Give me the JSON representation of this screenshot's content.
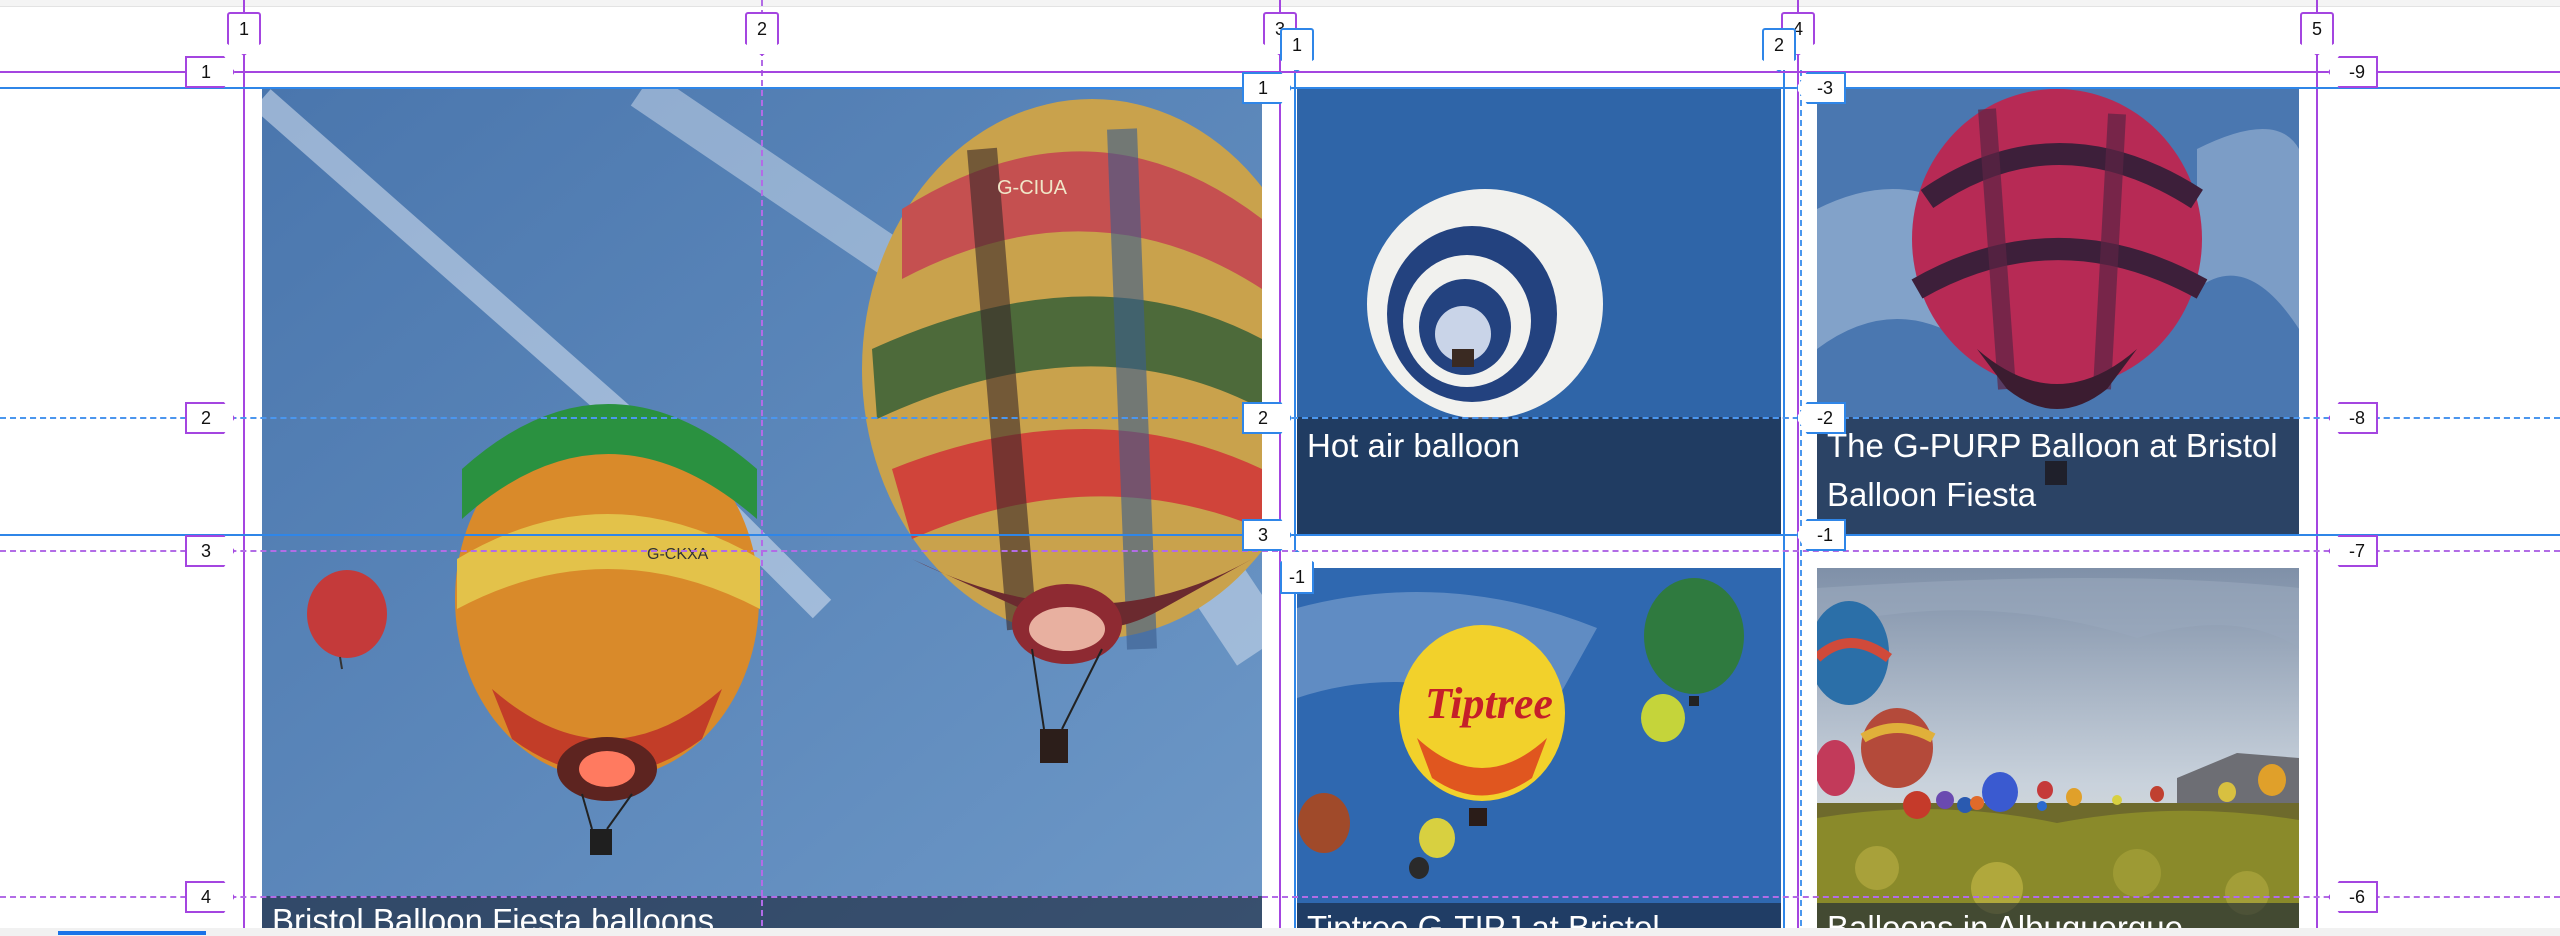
{
  "gallery": {
    "items": [
      {
        "caption": "Bristol Balloon Fiesta balloons"
      },
      {
        "caption": "Hot air balloon"
      },
      {
        "caption": "The G-PURP Balloon at Bristol Balloon Fiesta"
      },
      {
        "caption": "Tiptree G-TIPJ at Bristol"
      },
      {
        "caption": "Balloons in Albuquerque"
      }
    ]
  },
  "balloon_marks": {
    "left_large": "G-CIUA",
    "left_small": "G-CKXA",
    "tiptree": "Tiptree"
  },
  "grid_overlay": {
    "outer_columns": [
      "1",
      "2",
      "3",
      "4",
      "5"
    ],
    "outer_rows_left": [
      "1",
      "2",
      "3",
      "4"
    ],
    "outer_rows_right": [
      "-9",
      "-8",
      "-7",
      "-6"
    ],
    "inner_columns": [
      "1",
      "2"
    ],
    "inner_rows_left": [
      "1",
      "2",
      "3"
    ],
    "inner_rows_right": [
      "-3",
      "-2",
      "-1"
    ],
    "inner_column_end": "-1",
    "colors": {
      "outer": "#a445e0",
      "inner": "#2f86e8"
    }
  }
}
